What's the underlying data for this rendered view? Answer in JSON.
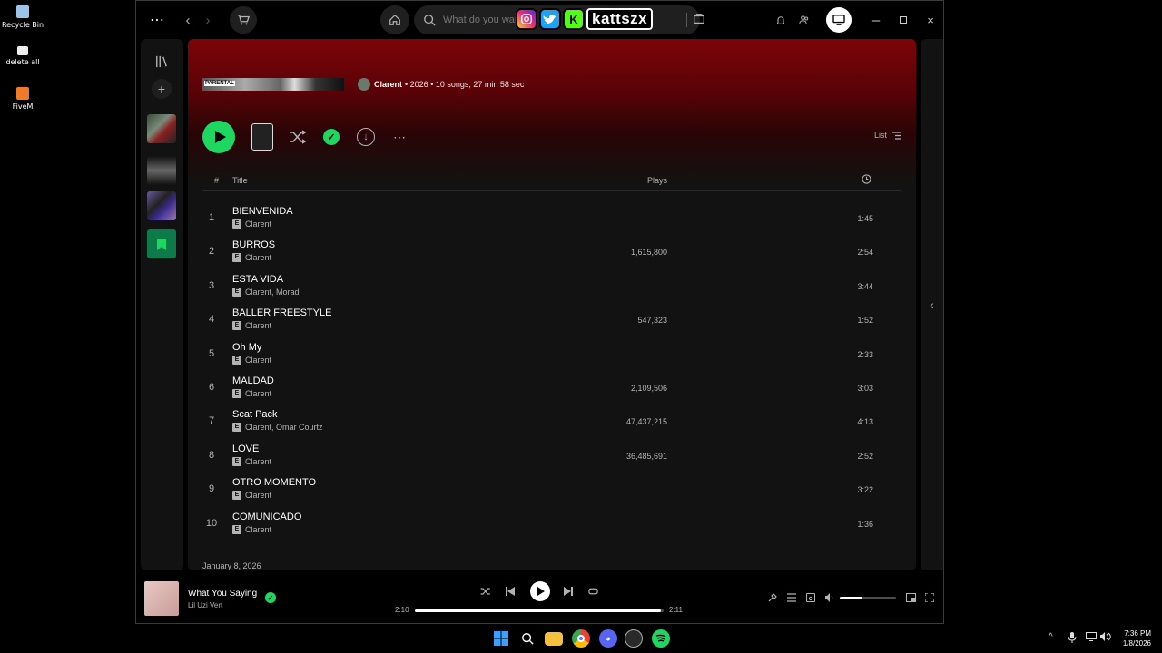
{
  "desktop": {
    "icons": [
      {
        "label": "Recycle Bin",
        "icon": "recycle-bin-icon"
      },
      {
        "label": "delete all",
        "icon": "file-icon"
      },
      {
        "label": "FiveM",
        "icon": "fivem-icon"
      }
    ]
  },
  "topbar": {
    "search_placeholder": "What do you war",
    "social_handle": "kattszx",
    "social_k": "K"
  },
  "album": {
    "artist": "Clarent",
    "details": "• 2026 • 10 songs, 27 min 58 sec",
    "explicit_badge": "PARENTAL",
    "view_label": "List"
  },
  "table": {
    "col_num": "#",
    "col_title": "Title",
    "col_plays": "Plays",
    "col_duration_icon": "clock-icon"
  },
  "tracks": [
    {
      "num": "1",
      "title": "BIENVENIDA",
      "artists": "Clarent",
      "plays": "",
      "duration": "1:45"
    },
    {
      "num": "2",
      "title": "BURROS",
      "artists": "Clarent",
      "plays": "1,615,800",
      "duration": "2:54"
    },
    {
      "num": "3",
      "title": "ESTA VIDA",
      "artists": "Clarent, Morad",
      "plays": "",
      "duration": "3:44"
    },
    {
      "num": "4",
      "title": "BALLER FREESTYLE",
      "artists": "Clarent",
      "plays": "547,323",
      "duration": "1:52"
    },
    {
      "num": "5",
      "title": "Oh My",
      "artists": "Clarent",
      "plays": "",
      "duration": "2:33"
    },
    {
      "num": "6",
      "title": "MALDAD",
      "artists": "Clarent",
      "plays": "2,109,506",
      "duration": "3:03"
    },
    {
      "num": "7",
      "title": "Scat Pack",
      "artists": "Clarent, Omar Courtz",
      "plays": "47,437,215",
      "duration": "4:13"
    },
    {
      "num": "8",
      "title": "LOVE",
      "artists": "Clarent",
      "plays": "36,485,691",
      "duration": "2:52"
    },
    {
      "num": "9",
      "title": "OTRO MOMENTO",
      "artists": "Clarent",
      "plays": "",
      "duration": "3:22"
    },
    {
      "num": "10",
      "title": "COMUNICADO",
      "artists": "Clarent",
      "plays": "",
      "duration": "1:36"
    }
  ],
  "explicit_letter": "E",
  "release_date": "January 8, 2026",
  "now_playing": {
    "title": "What You Saying",
    "artist": "Lil Uzi Vert",
    "elapsed": "2:10",
    "total": "2:11",
    "progress": 0.99,
    "volume": 0.4
  },
  "clock": {
    "time": "7:36 PM",
    "date": "1/8/2026"
  },
  "colors": {
    "accent": "#1ed760",
    "hero": "#7c0408"
  }
}
